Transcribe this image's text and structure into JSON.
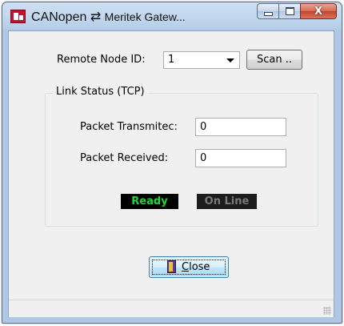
{
  "window": {
    "title_main": "CANopen ⇄ ",
    "title_rest": "Meritek Gatew...",
    "icon": "app-logo-icon"
  },
  "titlebar_buttons": {
    "minimize_icon": "minimize-icon",
    "maximize_icon": "maximize-icon",
    "close_glyph": "X"
  },
  "node": {
    "label": "Remote Node ID:",
    "value": "1",
    "scan_label": "Scan .."
  },
  "link": {
    "group_title": "Link Status (TCP)",
    "transmitted_label": "Packet Transmitec:",
    "transmitted_value": "0",
    "received_label": "Packet Received:",
    "received_value": "0",
    "ready_label": "Ready",
    "online_label": "On Line",
    "ready_color": "#22d43a",
    "online_color": "#7a7a7a"
  },
  "close_button": {
    "mnemonic": "C",
    "rest": "lose",
    "icon": "door-exit-icon"
  }
}
